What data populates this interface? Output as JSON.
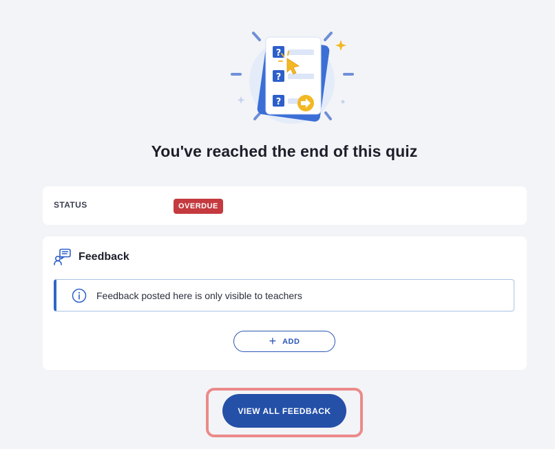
{
  "completion": {
    "title": "You've reached the end of this quiz",
    "illustration_icon": "quiz-checklist-illustration"
  },
  "status": {
    "label": "STATUS",
    "badge": "OVERDUE",
    "badge_color": "#c43a3f"
  },
  "feedback": {
    "title": "Feedback",
    "icon": "feedback-person-icon",
    "info_icon": "info-icon",
    "info_text": "Feedback posted here is only visible to teachers",
    "add_icon": "plus-icon",
    "add_label": "ADD"
  },
  "actions": {
    "view_all_label": "VIEW ALL FEEDBACK",
    "primary_color": "#2450a8"
  }
}
